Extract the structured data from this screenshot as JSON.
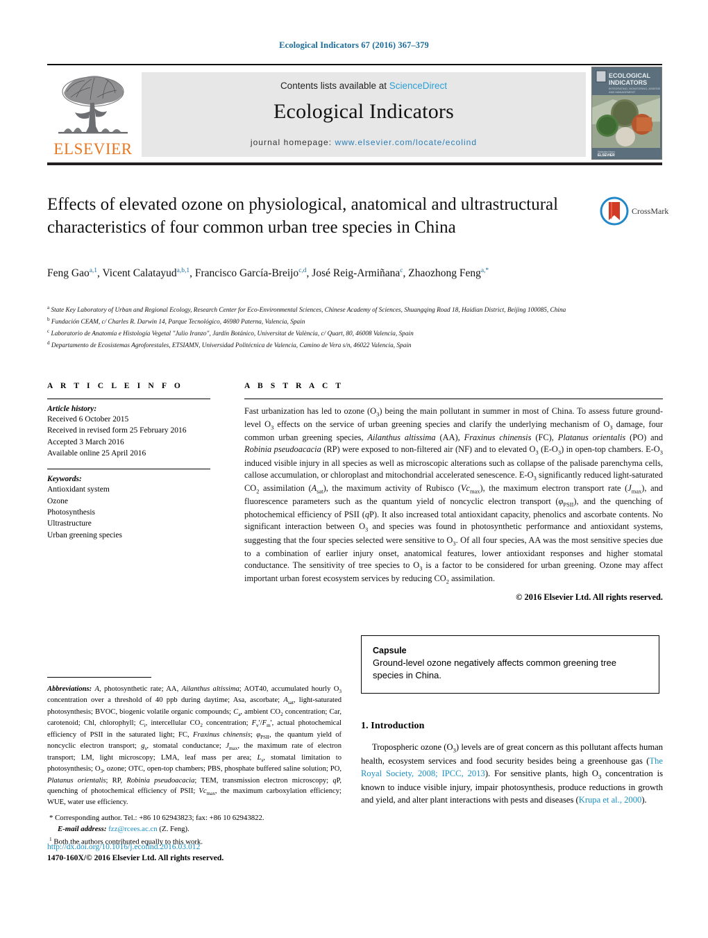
{
  "running_head": "Ecological Indicators 67 (2016) 367–379",
  "masthead": {
    "contents_prefix": "Contents lists available at ",
    "sciencedirect": "ScienceDirect",
    "journal_title": "Ecological Indicators",
    "homepage_label": "journal homepage: ",
    "homepage_url": "www.elsevier.com/locate/ecolind",
    "publisher": "ELSEVIER",
    "cover_line1": "ECOLOGICAL",
    "cover_line2": "INDICATORS"
  },
  "article": {
    "title": "Effects of elevated ozone on physiological, anatomical and ultrastructural characteristics of four common urban tree species in China",
    "crossmark_label": "CrossMark",
    "authors_html": "Feng Gao<sup>a,1</sup>, Vicent Calatayud<sup>a,b,1</sup>, Francisco García-Breijo<sup>c,d</sup>, José Reig-Armiñana<sup>c</sup>, Zhaozhong Feng<sup>a,*</sup>",
    "affiliations": [
      "a State Key Laboratory of Urban and Regional Ecology, Research Center for Eco-Environmental Sciences, Chinese Academy of Sciences, Shuangqing Road 18, Haidian District, Beijing 100085, China",
      "b Fundación CEAM, c/ Charles R. Darwin 14, Parque Tecnológico, 46980 Paterna, Valencia, Spain",
      "c Laboratorio de Anatomía e Histología Vegetal \"Julio Iranzo\", Jardín Botánico, Universitat de València, c/ Quart, 80, 46008 Valencia, Spain",
      "d Departamento de Ecosistemas Agroforestales, ETSIAMN, Universidad Politécnica de Valencia, Camino de Vera s/n, 46022 Valencia, Spain"
    ]
  },
  "article_info": {
    "heading": "A R T I C L E   I N F O",
    "history_label": "Article history:",
    "history": [
      "Received 6 October 2015",
      "Received in revised form 25 February 2016",
      "Accepted 3 March 2016",
      "Available online 25 April 2016"
    ],
    "keywords_label": "Keywords:",
    "keywords": [
      "Antioxidant system",
      "Ozone",
      "Photosynthesis",
      "Ultrastructure",
      "Urban greening species"
    ]
  },
  "abstract": {
    "heading": "A B S T R A C T",
    "body_html": "Fast urbanization has led to ozone (O<sub>3</sub>) being the main pollutant in summer in most of China. To assess future ground-level O<sub>3</sub> effects on the service of urban greening species and clarify the underlying mechanism of O<sub>3</sub> damage, four common urban greening species, <i>Ailanthus altissima</i> (AA), <i>Fraxinus chinensis</i> (FC), <i>Platanus orientalis</i> (PO) and <i>Robinia pseudoacacia</i> (RP) were exposed to non-filtered air (NF) and to elevated O<sub>3</sub> (E-O<sub>3</sub>) in open-top chambers. E-O<sub>3</sub> induced visible injury in all species as well as microscopic alterations such as collapse of the palisade parenchyma cells, callose accumulation, or chloroplast and mitochondrial accelerated senescence. E-O<sub>3</sub> significantly reduced light-saturated CO<sub>2</sub> assimilation (<i>A</i><sub>sat</sub>), the maximum activity of Rubisco (<i>Vc</i><sub>max</sub>), the maximum electron transport rate (<i>J</i><sub>max</sub>), and fluorescence parameters such as the quantum yield of noncyclic electron transport (<i>&phi;</i><sub>PSII</sub>), and the quenching of photochemical efficiency of PSII (<i>q</i>P). It also increased total antioxidant capacity, phenolics and ascorbate contents. No significant interaction between O<sub>3</sub> and species was found in photosynthetic performance and antioxidant systems, suggesting that the four species selected were sensitive to O<sub>3</sub>. Of all four species, AA was the most sensitive species due to a combination of earlier injury onset, anatomical features, lower antioxidant responses and higher stomatal conductance. The sensitivity of tree species to O<sub>3</sub> is a factor to be considered for urban greening. Ozone may affect important urban forest ecosystem services by reducing CO<sub>2</sub> assimilation.",
    "copyright": "© 2016 Elsevier Ltd. All rights reserved."
  },
  "capsule": {
    "title": "Capsule",
    "text": "Ground-level ozone negatively affects common greening tree species in China."
  },
  "footnotes": {
    "abbreviations_label": "Abbreviations:",
    "abbreviations_html": "<i>A</i>, photosynthetic rate; AA, <i>Ailanthus altissima</i>; AOT40, accumulated hourly O<sub>3</sub> concentration over a threshold of 40 ppb during daytime; Asa, ascorbate; <i>A</i><sub>sat</sub>, light-saturated photosynthesis; BVOC, biogenic volatile organic compounds; <i>C</i><sub>a</sub>, ambient CO<sub>2</sub> concentration; Car, carotenoid; Chl, chlorophyll; <i>C</i><sub>i</sub>, intercellular CO<sub>2</sub> concentration; <i>F</i><sub>v</sub>'/<i>F</i><sub>m</sub>', actual photochemical efficiency of PSII in the saturated light; FC, <i>Fraxinus chinensis</i>; <i>&phi;</i><sub>PSII</sub>, the quantum yield of noncyclic electron transport; <i>g</i><sub>s</sub>, stomatal conductance; <i>J</i><sub>max</sub>, the maximum rate of electron transport; LM, light microscopy; LMA, leaf mass per area; <i>L</i><sub>s</sub>, stomatal limitation to photosynthesis; O<sub>3</sub>, ozone; OTC, open-top chambers; PBS, phosphate buffered saline solution; PO, <i>Platanus orientalis</i>; RP, <i>Robinia pseudoacacia</i>; TEM, transmission electron microscopy; <i>q</i>P, quenching of photochemical efficiency of PSII; <i>Vc</i><sub>max</sub>, the maximum carboxylation efficiency; WUE, water use efficiency.",
    "corresponding_html": "Corresponding author. Tel.: +86 10 62943823; fax: +86 10 62943822.",
    "email_label": "E-mail address:",
    "email": "fzz@rcees.ac.cn",
    "email_owner": "(Z. Feng).",
    "equal_contrib": "Both the authors contributed equally to this work."
  },
  "footer": {
    "doi": "http://dx.doi.org/10.1016/j.ecolind.2016.03.012",
    "issn_line": "1470-160X/© 2016 Elsevier Ltd. All rights reserved."
  },
  "introduction": {
    "heading": "1. Introduction",
    "paragraph_html": "Tropospheric ozone (O<sub>3</sub>) levels are of great concern as this pollutant affects human health, ecosystem services and food security besides being a greenhouse gas (<span class=\"cite\">The Royal Society, 2008; IPCC, 2013</span>). For sensitive plants, high O<sub>3</sub> concentration is known to induce visible injury, impair photosynthesis, produce reductions in growth and yield, and alter plant interactions with pests and diseases (<span class=\"cite\">Krupa et al., 2000</span>)."
  },
  "colors": {
    "link": "#1a8fc1",
    "running_head": "#1a6b9a",
    "elsevier_orange": "#E87722",
    "masthead_bg": "#e7e7e7"
  }
}
